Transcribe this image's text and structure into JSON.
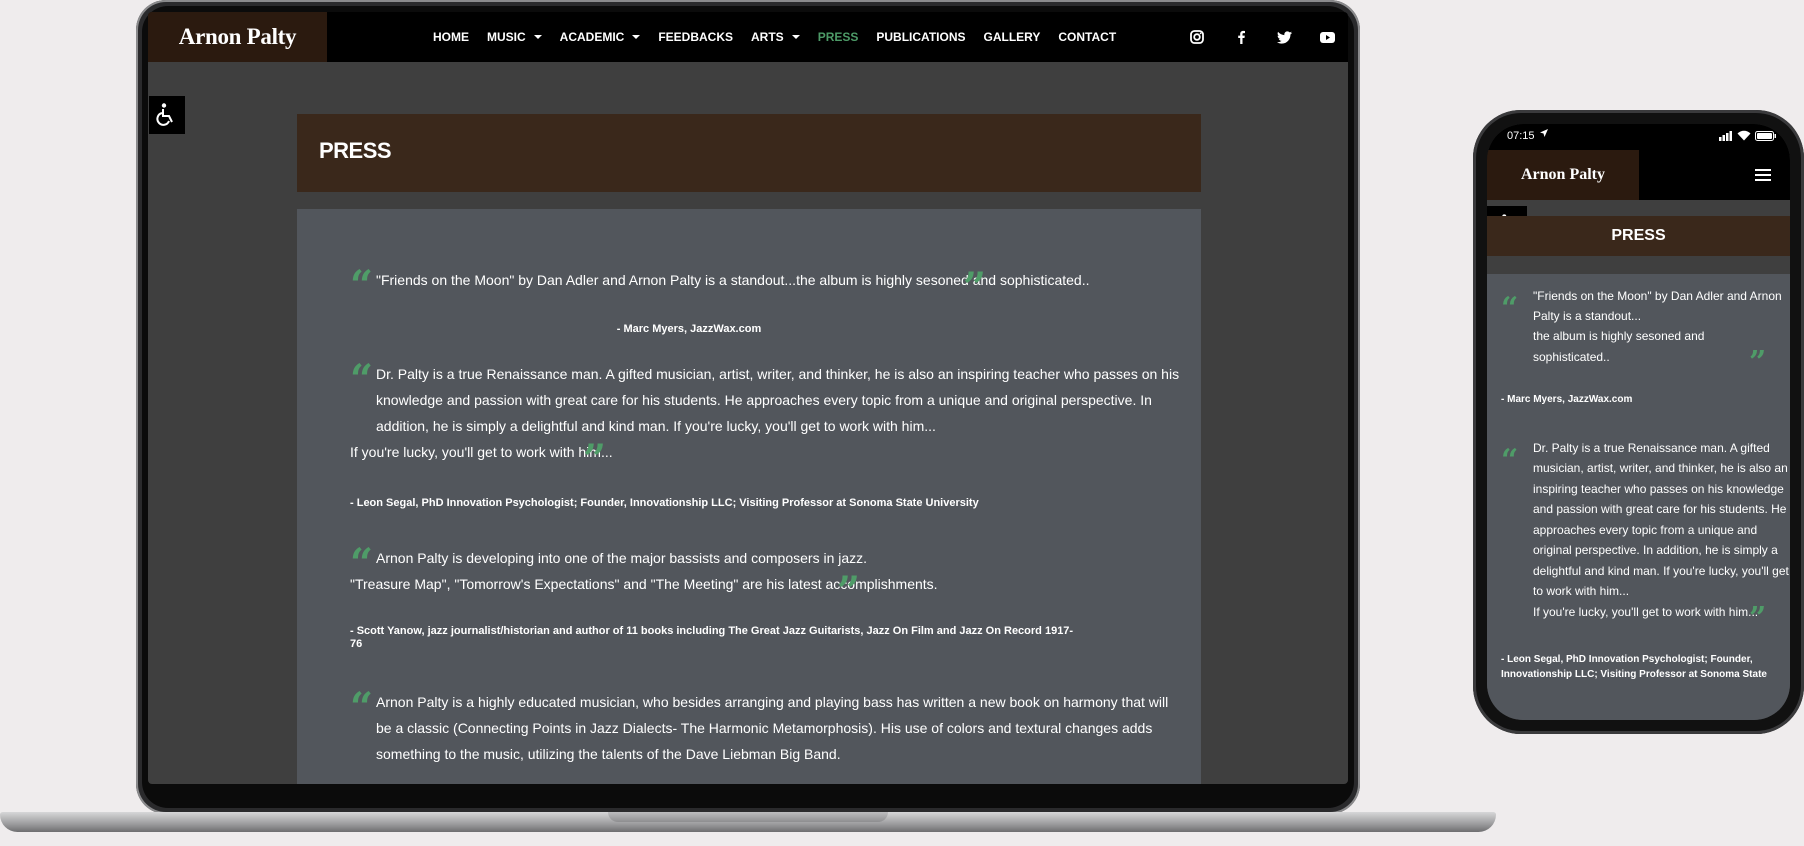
{
  "site": {
    "brand": "Arnon Palty",
    "nav": [
      {
        "label": "HOME",
        "dropdown": false,
        "active": false
      },
      {
        "label": "MUSIC",
        "dropdown": true,
        "active": false
      },
      {
        "label": "ACADEMIC",
        "dropdown": true,
        "active": false
      },
      {
        "label": "FEEDBACKS",
        "dropdown": false,
        "active": false
      },
      {
        "label": "ARTS",
        "dropdown": true,
        "active": false
      },
      {
        "label": "PRESS",
        "dropdown": false,
        "active": true
      },
      {
        "label": "PUBLICATIONS",
        "dropdown": false,
        "active": false
      },
      {
        "label": "GALLERY",
        "dropdown": false,
        "active": false
      },
      {
        "label": "CONTACT",
        "dropdown": false,
        "active": false
      }
    ],
    "social_icons": [
      "instagram-icon",
      "facebook-icon",
      "twitter-icon",
      "youtube-icon"
    ],
    "accessibility_icon": "wheelchair-icon",
    "colors": {
      "accent": "#4f9c68",
      "brand_bg": "#2b1a0f",
      "title_bar": "#3a281b",
      "content_bg": "#52565c"
    }
  },
  "page": {
    "title": "PRESS",
    "quotes": [
      {
        "lines": [
          "\"Friends on the Moon\" by Dan Adler and Arnon Palty is a standout...the album is highly sesoned and sophisticated.."
        ],
        "attribution": "- Marc Myers, JazzWax.com"
      },
      {
        "lines": [
          "Dr. Palty is a true Renaissance man. A gifted musician, artist, writer, and thinker, he is also an inspiring teacher who passes on his",
          "knowledge and passion with great care for his students. He approaches every topic from a unique and original perspective. In",
          "addition, he is simply a delightful and kind man. If you're lucky, you'll get to work with him...",
          "If you're lucky, you'll get to work with him..."
        ],
        "attribution": "- Leon Segal, PhD Innovation Psychologist; Founder, Innovationship LLC; Visiting Professor at Sonoma State University"
      },
      {
        "lines": [
          "Arnon Palty is developing into one of the major bassists and composers in jazz.",
          "\"Treasure Map\", \"Tomorrow's Expectations\" and \"The Meeting\" are his latest accomplishments."
        ],
        "attribution_lines": [
          "- Scott Yanow, jazz journalist/historian and author of 11 books including The Great Jazz Guitarists, Jazz On Film and Jazz On Record 1917-",
          "76"
        ]
      },
      {
        "lines": [
          "Arnon Palty is a highly educated musician, who besides arranging and playing bass has written a new book on harmony that will",
          "be a classic (Connecting Points in Jazz Dialects- The Harmonic Metamorphosis). His use of colors and textural changes adds",
          "something to the music, utilizing the talents of the Dave Liebman Big Band."
        ]
      }
    ]
  },
  "phone": {
    "time": "07:15",
    "brand": "Arnon Palty",
    "menu_icon": "hamburger-menu-icon",
    "title": "PRESS",
    "quote1_lines": [
      "\"Friends on the Moon\" by Dan Adler and Arnon",
      "Palty is a standout...",
      "the album is highly sesoned and",
      "sophisticated.."
    ],
    "quote1_attribution": "- Marc Myers, JazzWax.com",
    "quote2_lines": [
      "Dr. Palty is a true Renaissance man. A gifted",
      "musician, artist, writer, and thinker, he is also an",
      "inspiring teacher who passes on his knowledge",
      "and passion with great care for his students. He",
      "approaches every topic from a unique and",
      "original perspective. In addition, he is simply a",
      "delightful and kind man. If you're lucky, you'll get",
      "to work with him...",
      "If you're lucky, you'll get to work with him..."
    ],
    "quote2_attribution_lines": [
      "- Leon Segal, PhD Innovation Psychologist; Founder,",
      "Innovationship LLC; Visiting Professor at Sonoma State"
    ]
  }
}
